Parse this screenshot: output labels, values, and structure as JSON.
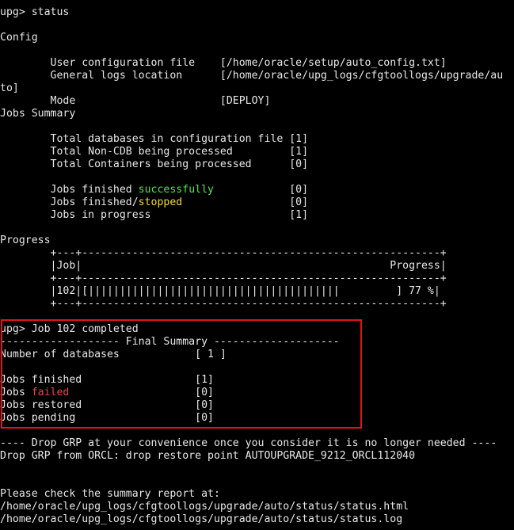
{
  "terminal": {
    "prompt_status": "upg> status",
    "config_header": "Config",
    "user_config_line": "        User configuration file    [/home/oracle/setup/auto_config.txt]",
    "general_logs_line": "        General logs location      [/home/oracle/upg_logs/cfgtoollogs/upgrade/au",
    "general_logs_wrap": "to]",
    "mode_line": "        Mode                       [DEPLOY]",
    "jobs_summary_header": "Jobs Summary",
    "total_db_line": "        Total databases in configuration file [1]",
    "total_noncdb_line": "        Total Non-CDB being processed         [1]",
    "total_containers_line": "        Total Containers being processed      [0]",
    "jobs_finished_prefix": "        Jobs finished ",
    "jobs_finished_word": "successfully",
    "jobs_finished_suffix": "            [0]",
    "jobs_stopped_prefix": "        Jobs finished/",
    "jobs_stopped_word": "stopped",
    "jobs_stopped_suffix": "                 [0]",
    "jobs_progress_line": "        Jobs in progress                      [1]",
    "progress_header": "Progress",
    "table_border": "        +---+---------------------------------------------------------+",
    "table_header": "        |Job|                                                 Progress|",
    "table_row": "        |102|[||||||||||||||||||||||||||||||||||||||||         ] 77 %|",
    "job_completed": "upg> Job 102 completed",
    "final_summary_title": "------------------- Final Summary --------------------",
    "num_databases_line": "Number of databases            [ 1 ]",
    "jobs_finished_final": "Jobs finished                  [1]",
    "jobs_failed_prefix": "Jobs ",
    "jobs_failed_word": "failed",
    "jobs_failed_suffix": "                    [0]",
    "jobs_restored_line": "Jobs restored                  [0]",
    "jobs_pending_line": "Jobs pending                   [0]",
    "drop_grp_notice": "---- Drop GRP at your convenience once you consider it is no longer needed ----",
    "drop_grp_line": "Drop GRP from ORCL: drop restore point AUTOUPGRADE_9212_ORCL112040",
    "summary_check": "Please check the summary report at:",
    "summary_html": "/home/oracle/upg_logs/cfgtoollogs/upgrade/auto/status/status.html",
    "summary_log": "/home/oracle/upg_logs/cfgtoollogs/upgrade/auto/status/status.log",
    "progress_percent": 77
  },
  "colors": {
    "background": "#000000",
    "text": "#e8e8e8",
    "success": "#4ee64e",
    "stopped": "#f5d83b",
    "failed": "#ee4444",
    "highlight_border": "#e0141a"
  }
}
